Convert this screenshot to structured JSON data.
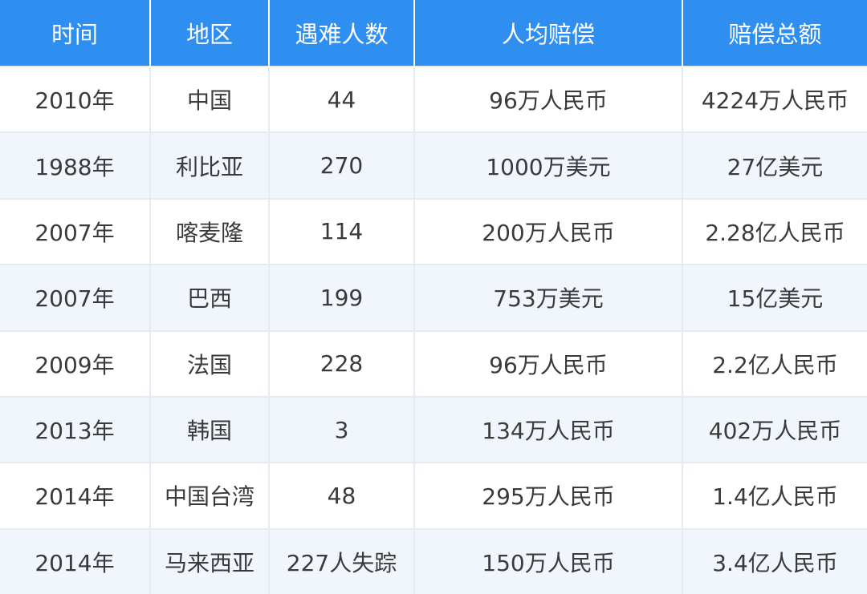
{
  "headers": [
    "时间",
    "地区",
    "遇难人数",
    "人均赔偿",
    "赔偿总额"
  ],
  "rows": [
    [
      "2010年",
      "中国",
      "44",
      "96万人民币",
      "4224万人民币"
    ],
    [
      "1988年",
      "利比亚",
      "270",
      "1000万美元",
      "27亿美元"
    ],
    [
      "2007年",
      "喀麦隆",
      "114",
      "200万人民币",
      "2.28亿人民币"
    ],
    [
      "2007年",
      "巴西",
      "199",
      "753万美元",
      "15亿美元"
    ],
    [
      "2009年",
      "法国",
      "228",
      "96万人民币",
      "2.2亿人民币"
    ],
    [
      "2013年",
      "韩国",
      "3",
      "134万人民币",
      "402万人民币"
    ],
    [
      "2014年",
      "中国台湾",
      "48",
      "295万人民币",
      "1.4亿人民币"
    ],
    [
      "2014年",
      "马来西亚",
      "227人失踪",
      "150万人民币",
      "3.4亿人民币"
    ]
  ],
  "colors": {
    "header_bg": "#2f8ff0",
    "header_text": "#ffffff",
    "stripe_bg": "#f1f6fc",
    "cell_text": "#3a3a3a",
    "grid_line": "#e6ebf1"
  }
}
